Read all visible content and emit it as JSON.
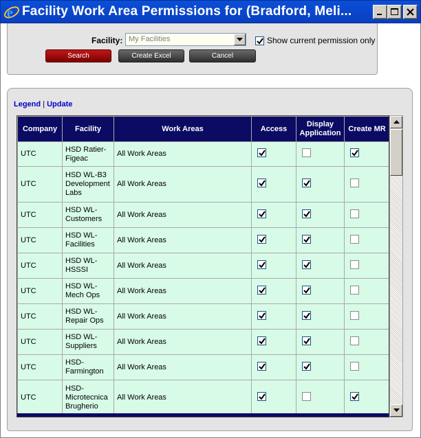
{
  "window": {
    "title": "Facility Work Area Permissions for (Bradford, Meli..."
  },
  "filter": {
    "facility_label": "Facility:",
    "facility_value": "My Facilities",
    "show_current_label": "Show current permission only",
    "show_current_checked": true,
    "search_label": "Search",
    "create_excel_label": "Create Excel",
    "cancel_label": "Cancel"
  },
  "links": {
    "legend": "Legend",
    "separator": "|",
    "update": "Update"
  },
  "table": {
    "headers": [
      "Company",
      "Facility",
      "Work Areas",
      "Access",
      "Display Application",
      "Create MR"
    ],
    "rows": [
      {
        "company": "UTC",
        "facility": "HSD Ratier-Figeac",
        "work_areas": "All Work Areas",
        "access": true,
        "display_application": false,
        "create_mr": true
      },
      {
        "company": "UTC",
        "facility": "HSD WL-B3 Development Labs",
        "work_areas": "All Work Areas",
        "access": true,
        "display_application": true,
        "create_mr": false
      },
      {
        "company": "UTC",
        "facility": "HSD WL-Customers",
        "work_areas": "All Work Areas",
        "access": true,
        "display_application": true,
        "create_mr": false
      },
      {
        "company": "UTC",
        "facility": "HSD WL-Facilities",
        "work_areas": "All Work Areas",
        "access": true,
        "display_application": true,
        "create_mr": false
      },
      {
        "company": "UTC",
        "facility": "HSD WL-HSSSI",
        "work_areas": "All Work Areas",
        "access": true,
        "display_application": true,
        "create_mr": false
      },
      {
        "company": "UTC",
        "facility": "HSD WL-Mech Ops",
        "work_areas": "All Work Areas",
        "access": true,
        "display_application": true,
        "create_mr": false
      },
      {
        "company": "UTC",
        "facility": "HSD WL-Repair Ops",
        "work_areas": "All Work Areas",
        "access": true,
        "display_application": true,
        "create_mr": false
      },
      {
        "company": "UTC",
        "facility": "HSD WL-Suppliers",
        "work_areas": "All Work Areas",
        "access": true,
        "display_application": true,
        "create_mr": false
      },
      {
        "company": "UTC",
        "facility": "HSD-Farmington",
        "work_areas": "All Work Areas",
        "access": true,
        "display_application": true,
        "create_mr": false
      },
      {
        "company": "UTC",
        "facility": "HSD-Microtecnica Brugherio",
        "work_areas": "All Work Areas",
        "access": true,
        "display_application": false,
        "create_mr": true
      }
    ]
  },
  "colors": {
    "title_bar": "#0a46cc",
    "header_bg": "#0b0b63",
    "row_bg": "#d8fbe8",
    "search_button": "#a01010",
    "link": "#0000cc"
  }
}
